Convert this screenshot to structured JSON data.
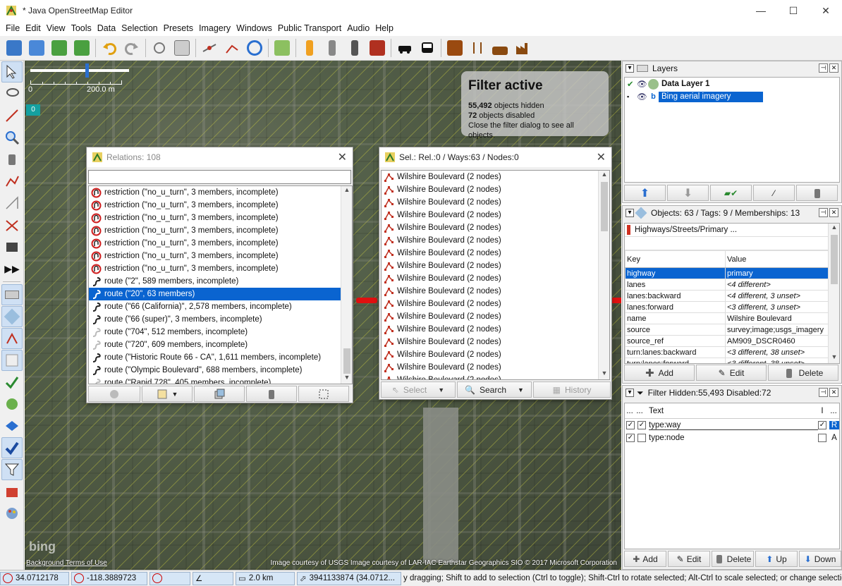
{
  "window": {
    "title": "* Java OpenStreetMap Editor",
    "minimize": "—",
    "maximize": "☐",
    "close": "✕"
  },
  "menu": [
    "File",
    "Edit",
    "View",
    "Tools",
    "Data",
    "Selection",
    "Presets",
    "Imagery",
    "Windows",
    "Public Transport",
    "Audio",
    "Help"
  ],
  "toolbar_icons": [
    "open-icon",
    "save-icon",
    "download-icon",
    "upload-icon",
    "undo-icon",
    "redo-icon",
    "preferences-icon",
    "changeset-icon",
    "split-way-icon",
    "combine-way-icon",
    "reverse-way-icon",
    "align-circle-icon",
    "preset-highway-icon",
    "preset-street-icon",
    "preset-traffic-signal-icon",
    "preset-building-icon",
    "preset-car-icon",
    "preset-bus-icon",
    "preset-attention-icon",
    "preset-restaurant-icon",
    "preset-castle-icon",
    "preset-industrial-icon"
  ],
  "map": {
    "scale_start": "0",
    "scale_end": "200.0 m",
    "zoom_badge": "0",
    "filter": {
      "heading": "Filter active",
      "hidden_count": "55,492",
      "hidden_text": " objects hidden",
      "disabled_count": "72",
      "disabled_text": " objects disabled",
      "note": "Close the filter dialog to see all objects."
    },
    "attribution": "Image courtesy of USGS Image courtesy of LAR-IAC Earthstar Geographics  SIO © 2017 Microsoft Corporation",
    "background_terms": "Background Terms of Use",
    "bing_logo": "bing"
  },
  "relations_dialog": {
    "title": "Relations: 108",
    "filter_value": "",
    "items": [
      {
        "text": "restriction (\"no_u_turn\", 3 members, incomplete)",
        "icon": "no-u-turn-icon"
      },
      {
        "text": "restriction (\"no_u_turn\", 3 members, incomplete)",
        "icon": "no-u-turn-icon"
      },
      {
        "text": "restriction (\"no_u_turn\", 3 members, incomplete)",
        "icon": "no-u-turn-icon"
      },
      {
        "text": "restriction (\"no_u_turn\", 3 members, incomplete)",
        "icon": "no-u-turn-icon"
      },
      {
        "text": "restriction (\"no_u_turn\", 3 members, incomplete)",
        "icon": "no-u-turn-icon"
      },
      {
        "text": "restriction (\"no_u_turn\", 3 members, incomplete)",
        "icon": "no-u-turn-icon"
      },
      {
        "text": "restriction (\"no_u_turn\", 3 members, incomplete)",
        "icon": "no-u-turn-icon"
      },
      {
        "text": "route (\"2\", 589 members, incomplete)",
        "icon": "route-icon"
      },
      {
        "text": "route (\"20\", 63 members)",
        "icon": "route-icon",
        "selected": true
      },
      {
        "text": "route (\"66 (California)\", 2,578 members, incomplete)",
        "icon": "route-icon"
      },
      {
        "text": "route (\"66 (super)\", 3 members, incomplete)",
        "icon": "route-icon"
      },
      {
        "text": "route (\"704\", 512 members, incomplete)",
        "icon": "route-faded-icon"
      },
      {
        "text": "route (\"720\", 609 members, incomplete)",
        "icon": "route-faded-icon"
      },
      {
        "text": "route (\"Historic Route 66 - CA\", 1,611 members, incomplete)",
        "icon": "route-icon"
      },
      {
        "text": "route (\"Olympic Boulevard\", 688 members, incomplete)",
        "icon": "route-icon"
      },
      {
        "text": "route (\"Rapid 728\", 405 members, incomplete)",
        "icon": "route-faded-icon"
      }
    ]
  },
  "selection_dialog": {
    "title": "Sel.: Rel.:0 / Ways:63 / Nodes:0",
    "items": [
      "Wilshire Boulevard (2 nodes)",
      "Wilshire Boulevard (2 nodes)",
      "Wilshire Boulevard (2 nodes)",
      "Wilshire Boulevard (2 nodes)",
      "Wilshire Boulevard (2 nodes)",
      "Wilshire Boulevard (2 nodes)",
      "Wilshire Boulevard (2 nodes)",
      "Wilshire Boulevard (2 nodes)",
      "Wilshire Boulevard (2 nodes)",
      "Wilshire Boulevard (2 nodes)",
      "Wilshire Boulevard (2 nodes)",
      "Wilshire Boulevard (2 nodes)",
      "Wilshire Boulevard (2 nodes)",
      "Wilshire Boulevard (2 nodes)",
      "Wilshire Boulevard (2 nodes)",
      "Wilshire Boulevard (2 nodes)",
      "Wilshire Boulevard (2 nodes)"
    ],
    "buttons": {
      "select": "Select",
      "search": "Search",
      "history": "History"
    }
  },
  "layers_panel": {
    "title": "Layers",
    "layers": [
      {
        "name": "Data Layer 1",
        "bold": true
      },
      {
        "name": "Bing aerial imagery",
        "selected": true
      }
    ]
  },
  "tags_panel": {
    "title": "Objects: 63 / Tags: 9 / Memberships: 13",
    "preset": "Highways/Streets/Primary ...",
    "col_key": "Key",
    "col_value": "Value",
    "rows": [
      {
        "key": "highway",
        "value": "primary",
        "selected": true
      },
      {
        "key": "lanes",
        "value": "<4 different>",
        "italic": true
      },
      {
        "key": "lanes:backward",
        "value": "<4 different, 3 unset>",
        "italic": true
      },
      {
        "key": "lanes:forward",
        "value": "<3 different, 3 unset>",
        "italic": true
      },
      {
        "key": "name",
        "value": "Wilshire Boulevard"
      },
      {
        "key": "source",
        "value": "survey;image;usgs_imagery"
      },
      {
        "key": "source_ref",
        "value": "AM909_DSCR0460"
      },
      {
        "key": "turn:lanes:backward",
        "value": "<3 different, 38 unset>",
        "italic": true
      },
      {
        "key": "turn:lanes:forward",
        "value": "<3 different, 38 unset>",
        "italic": true
      }
    ],
    "buttons": {
      "add": "Add",
      "edit": "Edit",
      "delete": "Delete"
    }
  },
  "filter_panel": {
    "title": "Filter Hidden:55,493 Disabled:72",
    "col_dots": "...",
    "col_dots2": "...",
    "col_text": "Text",
    "col_i": "I",
    "col_end": "...",
    "rows": [
      {
        "text": "type:way",
        "flag": "R",
        "checked_e": true,
        "checked_h": true,
        "checked_i": true
      },
      {
        "text": "type:node",
        "flag": "A",
        "checked_e": true,
        "checked_h": false,
        "checked_i": false
      }
    ],
    "buttons": {
      "add": "Add",
      "edit": "Edit",
      "delete": "Delete",
      "up": "Up",
      "down": "Down"
    }
  },
  "statusbar": {
    "lat": "34.0712178",
    "lon": "-118.3889723",
    "distance": "2.0 km",
    "id": "3941133874 (34.0712...",
    "message": "y dragging; Shift to add to selection (Ctrl to toggle); Shift-Ctrl to rotate selected; Alt-Ctrl to scale selected; or change selection"
  },
  "colors": {
    "selection": "#0a64d0",
    "status_field": "#d6e6f6",
    "filter_badge": "#14a0a0",
    "way_red": "#e01010"
  }
}
